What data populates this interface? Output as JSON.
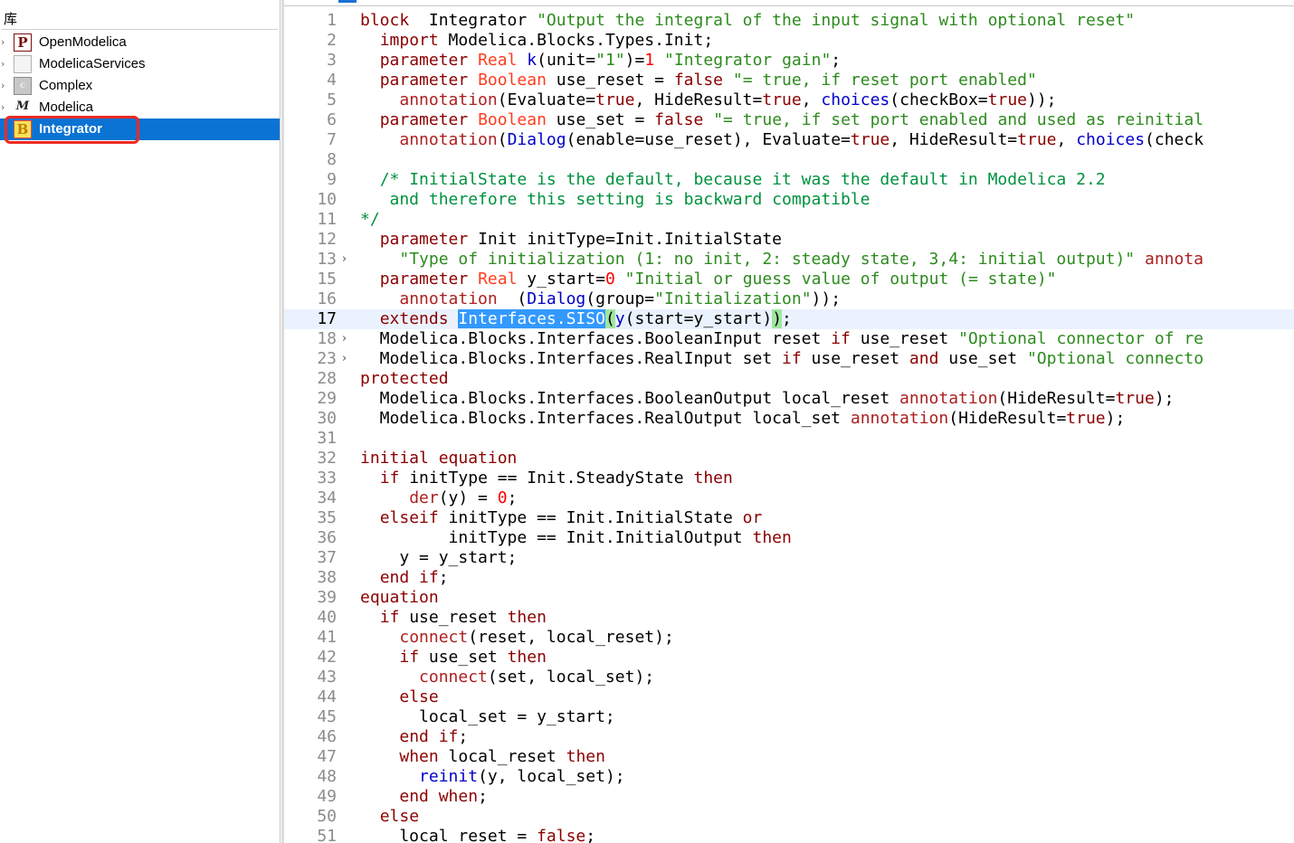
{
  "library_panel": {
    "title": "库",
    "items": [
      {
        "label": "OpenModelica",
        "icon": "P",
        "icon_name": "openmodelica-package-icon",
        "expander": "›"
      },
      {
        "label": "ModelicaServices",
        "icon": "",
        "icon_name": "package-icon",
        "expander": "›"
      },
      {
        "label": "Complex",
        "icon": "c",
        "icon_name": "complex-package-icon",
        "expander": "›"
      },
      {
        "label": "Modelica",
        "icon": "M",
        "icon_name": "modelica-library-icon",
        "expander": "›"
      },
      {
        "label": "Integrator",
        "icon": "B",
        "icon_name": "block-icon",
        "expander": ""
      }
    ],
    "selected": "Integrator",
    "colors": {
      "selection": "#0a73d3",
      "highlight_box": "#ee2a23"
    }
  },
  "editor": {
    "current_line": "17",
    "lines": [
      {
        "n": "1",
        "fold": "",
        "tokens": [
          [
            "kw",
            "block"
          ],
          [
            "",
            "  Integrator "
          ],
          [
            "st",
            "\"Output the integral of the input signal with optional reset\""
          ]
        ]
      },
      {
        "n": "2",
        "fold": "",
        "tokens": [
          [
            "",
            "  "
          ],
          [
            "kw",
            "import"
          ],
          [
            "",
            " Modelica.Blocks.Types.Init;"
          ]
        ]
      },
      {
        "n": "3",
        "fold": "",
        "tokens": [
          [
            "",
            "  "
          ],
          [
            "kw",
            "parameter"
          ],
          [
            "",
            " "
          ],
          [
            "ty",
            "Real"
          ],
          [
            "",
            " "
          ],
          [
            "fn",
            "k"
          ],
          [
            "",
            "(unit="
          ],
          [
            "st",
            "\"1\""
          ],
          [
            "",
            ")="
          ],
          [
            "nm",
            "1"
          ],
          [
            "",
            " "
          ],
          [
            "st",
            "\"Integrator gain\""
          ],
          [
            "",
            ";"
          ]
        ]
      },
      {
        "n": "4",
        "fold": "",
        "tokens": [
          [
            "",
            "  "
          ],
          [
            "kw",
            "parameter"
          ],
          [
            "",
            " "
          ],
          [
            "ty",
            "Boolean"
          ],
          [
            "",
            " use_reset = "
          ],
          [
            "kw",
            "false"
          ],
          [
            "",
            " "
          ],
          [
            "st",
            "\"= true, if reset port enabled\""
          ]
        ]
      },
      {
        "n": "5",
        "fold": "",
        "tokens": [
          [
            "",
            "    "
          ],
          [
            "an",
            "annotation"
          ],
          [
            "",
            "(Evaluate="
          ],
          [
            "kw",
            "true"
          ],
          [
            "",
            ", HideResult="
          ],
          [
            "kw",
            "true"
          ],
          [
            "",
            ", "
          ],
          [
            "fn",
            "choices"
          ],
          [
            "",
            "(checkBox="
          ],
          [
            "kw",
            "true"
          ],
          [
            "",
            "));"
          ]
        ]
      },
      {
        "n": "6",
        "fold": "",
        "tokens": [
          [
            "",
            "  "
          ],
          [
            "kw",
            "parameter"
          ],
          [
            "",
            " "
          ],
          [
            "ty",
            "Boolean"
          ],
          [
            "",
            " use_set = "
          ],
          [
            "kw",
            "false"
          ],
          [
            "",
            " "
          ],
          [
            "st",
            "\"= true, if set port enabled and used as reinitial"
          ]
        ]
      },
      {
        "n": "7",
        "fold": "",
        "tokens": [
          [
            "",
            "    "
          ],
          [
            "an",
            "annotation"
          ],
          [
            "",
            "("
          ],
          [
            "fn",
            "Dialog"
          ],
          [
            "",
            "(enable=use_reset), Evaluate="
          ],
          [
            "kw",
            "true"
          ],
          [
            "",
            ", HideResult="
          ],
          [
            "kw",
            "true"
          ],
          [
            "",
            ", "
          ],
          [
            "fn",
            "choices"
          ],
          [
            "",
            "(check"
          ]
        ]
      },
      {
        "n": "8",
        "fold": "",
        "tokens": []
      },
      {
        "n": "9",
        "fold": "",
        "tokens": [
          [
            "",
            "  "
          ],
          [
            "cm",
            "/* InitialState is the default, because it was the default in Modelica 2.2"
          ]
        ]
      },
      {
        "n": "10",
        "fold": "",
        "tokens": [
          [
            "cm",
            "   and therefore this setting is backward compatible"
          ]
        ]
      },
      {
        "n": "11",
        "fold": "",
        "tokens": [
          [
            "cm",
            "*/"
          ]
        ]
      },
      {
        "n": "12",
        "fold": "",
        "tokens": [
          [
            "",
            "  "
          ],
          [
            "kw",
            "parameter"
          ],
          [
            "",
            " Init initType=Init.InitialState"
          ]
        ]
      },
      {
        "n": "13",
        "fold": "›",
        "tokens": [
          [
            "",
            "    "
          ],
          [
            "st",
            "\"Type of initialization (1: no init, 2: steady state, 3,4: initial output)\""
          ],
          [
            "",
            " "
          ],
          [
            "an",
            "annota"
          ]
        ]
      },
      {
        "n": "15",
        "fold": "",
        "tokens": [
          [
            "",
            "  "
          ],
          [
            "kw",
            "parameter"
          ],
          [
            "",
            " "
          ],
          [
            "ty",
            "Real"
          ],
          [
            "",
            " y_start="
          ],
          [
            "nm",
            "0"
          ],
          [
            "",
            " "
          ],
          [
            "st",
            "\"Initial or guess value of output (= state)\""
          ]
        ]
      },
      {
        "n": "16",
        "fold": "",
        "tokens": [
          [
            "",
            "    "
          ],
          [
            "an",
            "annotation"
          ],
          [
            "",
            "  ("
          ],
          [
            "fn",
            "Dialog"
          ],
          [
            "",
            "(group="
          ],
          [
            "st",
            "\"Initialization\""
          ],
          [
            "",
            "));"
          ]
        ]
      },
      {
        "n": "17",
        "fold": "",
        "tokens": [
          [
            "",
            "  "
          ],
          [
            "kw",
            "extends"
          ],
          [
            "",
            " "
          ],
          [
            "sel",
            "Interfaces.SISO"
          ],
          [
            "par",
            "("
          ],
          [
            "fn",
            "y"
          ],
          [
            "",
            "(start=y_start)"
          ],
          [
            "par",
            ")"
          ],
          [
            "",
            ";"
          ]
        ]
      },
      {
        "n": "18",
        "fold": "›",
        "tokens": [
          [
            "",
            "  Modelica.Blocks.Interfaces.BooleanInput reset "
          ],
          [
            "kw",
            "if"
          ],
          [
            "",
            " use_reset "
          ],
          [
            "st",
            "\"Optional connector of re"
          ]
        ]
      },
      {
        "n": "23",
        "fold": "›",
        "tokens": [
          [
            "",
            "  Modelica.Blocks.Interfaces.RealInput set "
          ],
          [
            "kw",
            "if"
          ],
          [
            "",
            " use_reset "
          ],
          [
            "kw",
            "and"
          ],
          [
            "",
            " use_set "
          ],
          [
            "st",
            "\"Optional connecto"
          ]
        ]
      },
      {
        "n": "28",
        "fold": "",
        "tokens": [
          [
            "kw",
            "protected"
          ]
        ]
      },
      {
        "n": "29",
        "fold": "",
        "tokens": [
          [
            "",
            "  Modelica.Blocks.Interfaces.BooleanOutput local_reset "
          ],
          [
            "an",
            "annotation"
          ],
          [
            "",
            "(HideResult="
          ],
          [
            "kw",
            "true"
          ],
          [
            "",
            ");"
          ]
        ]
      },
      {
        "n": "30",
        "fold": "",
        "tokens": [
          [
            "",
            "  Modelica.Blocks.Interfaces.RealOutput local_set "
          ],
          [
            "an",
            "annotation"
          ],
          [
            "",
            "(HideResult="
          ],
          [
            "kw",
            "true"
          ],
          [
            "",
            ");"
          ]
        ]
      },
      {
        "n": "31",
        "fold": "",
        "tokens": []
      },
      {
        "n": "32",
        "fold": "",
        "tokens": [
          [
            "kw",
            "initial equation"
          ]
        ]
      },
      {
        "n": "33",
        "fold": "",
        "tokens": [
          [
            "",
            "  "
          ],
          [
            "kw",
            "if"
          ],
          [
            "",
            " initType == Init.SteadyState "
          ],
          [
            "kw",
            "then"
          ]
        ]
      },
      {
        "n": "34",
        "fold": "",
        "tokens": [
          [
            "",
            "     "
          ],
          [
            "an",
            "der"
          ],
          [
            "",
            "(y) = "
          ],
          [
            "nm",
            "0"
          ],
          [
            "",
            ";"
          ]
        ]
      },
      {
        "n": "35",
        "fold": "",
        "tokens": [
          [
            "",
            "  "
          ],
          [
            "kw",
            "elseif"
          ],
          [
            "",
            " initType == Init.InitialState "
          ],
          [
            "kw",
            "or"
          ]
        ]
      },
      {
        "n": "36",
        "fold": "",
        "tokens": [
          [
            "",
            "         initType == Init.InitialOutput "
          ],
          [
            "kw",
            "then"
          ]
        ]
      },
      {
        "n": "37",
        "fold": "",
        "tokens": [
          [
            "",
            "    y = y_start;"
          ]
        ]
      },
      {
        "n": "38",
        "fold": "",
        "tokens": [
          [
            "",
            "  "
          ],
          [
            "kw",
            "end if"
          ],
          [
            "",
            ";"
          ]
        ]
      },
      {
        "n": "39",
        "fold": "",
        "tokens": [
          [
            "kw",
            "equation"
          ]
        ]
      },
      {
        "n": "40",
        "fold": "",
        "tokens": [
          [
            "",
            "  "
          ],
          [
            "kw",
            "if"
          ],
          [
            "",
            " use_reset "
          ],
          [
            "kw",
            "then"
          ]
        ]
      },
      {
        "n": "41",
        "fold": "",
        "tokens": [
          [
            "",
            "    "
          ],
          [
            "an",
            "connect"
          ],
          [
            "",
            "(reset, local_reset);"
          ]
        ]
      },
      {
        "n": "42",
        "fold": "",
        "tokens": [
          [
            "",
            "    "
          ],
          [
            "kw",
            "if"
          ],
          [
            "",
            " use_set "
          ],
          [
            "kw",
            "then"
          ]
        ]
      },
      {
        "n": "43",
        "fold": "",
        "tokens": [
          [
            "",
            "      "
          ],
          [
            "an",
            "connect"
          ],
          [
            "",
            "(set, local_set);"
          ]
        ]
      },
      {
        "n": "44",
        "fold": "",
        "tokens": [
          [
            "",
            "    "
          ],
          [
            "kw",
            "else"
          ]
        ]
      },
      {
        "n": "45",
        "fold": "",
        "tokens": [
          [
            "",
            "      local_set = y_start;"
          ]
        ]
      },
      {
        "n": "46",
        "fold": "",
        "tokens": [
          [
            "",
            "    "
          ],
          [
            "kw",
            "end if"
          ],
          [
            "",
            ";"
          ]
        ]
      },
      {
        "n": "47",
        "fold": "",
        "tokens": [
          [
            "",
            "    "
          ],
          [
            "kw",
            "when"
          ],
          [
            "",
            " local_reset "
          ],
          [
            "kw",
            "then"
          ]
        ]
      },
      {
        "n": "48",
        "fold": "",
        "tokens": [
          [
            "",
            "      "
          ],
          [
            "fn",
            "reinit"
          ],
          [
            "",
            "(y, local_set);"
          ]
        ]
      },
      {
        "n": "49",
        "fold": "",
        "tokens": [
          [
            "",
            "    "
          ],
          [
            "kw",
            "end when"
          ],
          [
            "",
            ";"
          ]
        ]
      },
      {
        "n": "50",
        "fold": "",
        "tokens": [
          [
            "",
            "  "
          ],
          [
            "kw",
            "else"
          ]
        ]
      },
      {
        "n": "51",
        "fold": "",
        "tokens": [
          [
            "",
            "    local_reset = "
          ],
          [
            "kw",
            "false"
          ],
          [
            "",
            ";"
          ]
        ]
      }
    ]
  }
}
